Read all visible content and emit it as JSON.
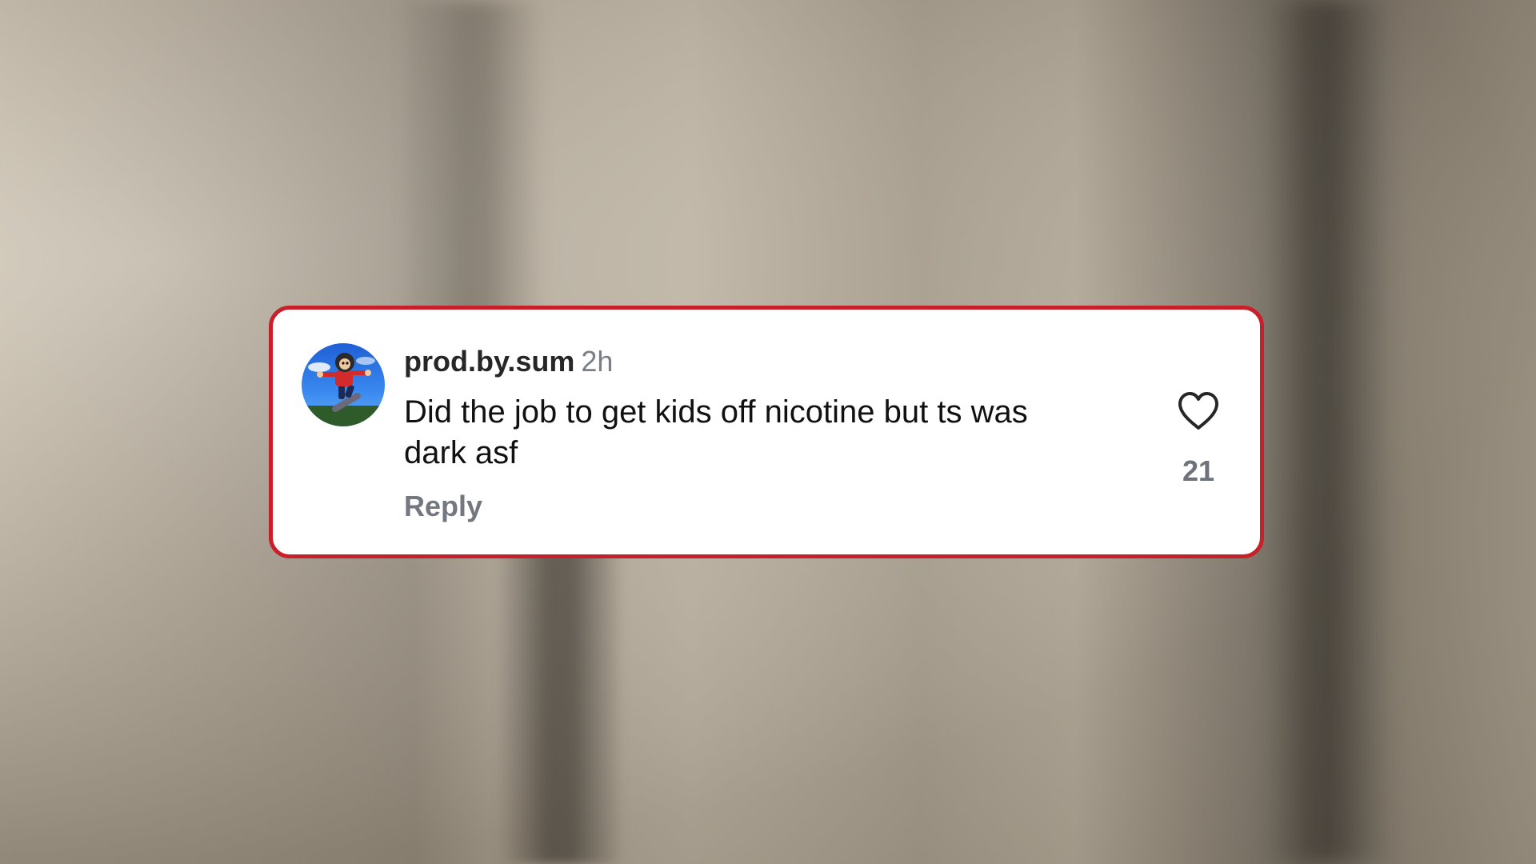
{
  "comment": {
    "username": "prod.by.sum",
    "time": "2h",
    "text": "Did the job to get kids off nicotine but ts was dark asf",
    "reply_label": "Reply",
    "like_count": "21",
    "avatar_icon": "skateboarder-avatar",
    "like_icon": "heart-outline-icon"
  },
  "colors": {
    "card_border": "#c8202a",
    "username": "#262626",
    "secondary_text": "#737880"
  }
}
